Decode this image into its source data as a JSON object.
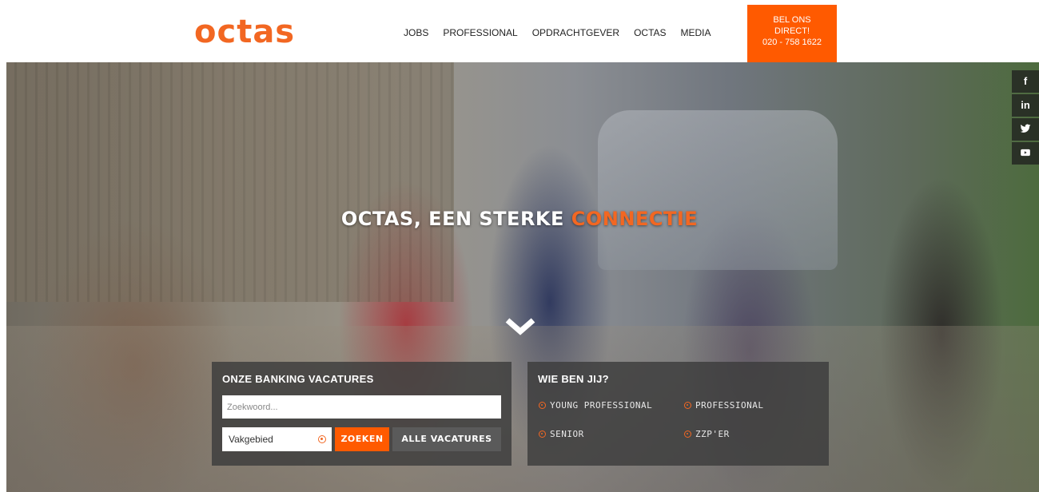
{
  "brand": {
    "logo": "octas",
    "accent_color": "#f26722",
    "cta_color": "#ff5a00"
  },
  "nav": {
    "items": [
      {
        "label": "JOBS"
      },
      {
        "label": "PROFESSIONAL"
      },
      {
        "label": "OPDRACHTGEVER"
      },
      {
        "label": "OCTAS"
      },
      {
        "label": "MEDIA"
      }
    ]
  },
  "callbox": {
    "line1": "BEL ONS",
    "line2": "DIRECT!",
    "phone": "020 - 758 1622"
  },
  "social": [
    {
      "icon": "facebook-icon",
      "glyph": "f"
    },
    {
      "icon": "linkedin-icon",
      "glyph": "in"
    },
    {
      "icon": "twitter-icon",
      "glyph": "🐦"
    },
    {
      "icon": "youtube-icon",
      "glyph": "▶"
    }
  ],
  "hero": {
    "tagline_main": "OCTAS, EEN STERKE ",
    "tagline_accent": "CONNECTIE",
    "scroll_icon": "chevron-down-icon"
  },
  "search_panel": {
    "title": "ONZE BANKING VACATURES",
    "input_placeholder": "Zoekwoord...",
    "select_value": "Vakgebied",
    "search_button": "ZOEKEN",
    "all_button": "ALLE VACATURES"
  },
  "who_panel": {
    "title": "WIE BEN JIJ?",
    "items": [
      {
        "label": "YOUNG PROFESSIONAL"
      },
      {
        "label": "PROFESSIONAL"
      },
      {
        "label": "SENIOR"
      },
      {
        "label": "ZZP'ER"
      }
    ]
  }
}
